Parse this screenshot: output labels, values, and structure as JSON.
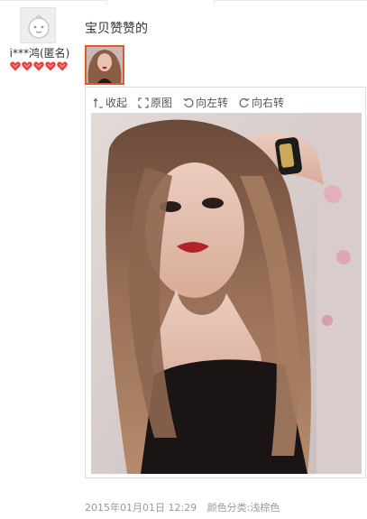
{
  "review": {
    "username": "i***鸿(匿名)",
    "rating_hearts": 5,
    "text": "宝贝赞赞的",
    "date": "2015年01月01日 12:29",
    "sku": "颜色分类:浅棕色"
  },
  "viewer": {
    "tools": [
      {
        "label": "收起",
        "icon": "collapse-icon"
      },
      {
        "label": "原图",
        "icon": "fullsize-icon"
      },
      {
        "label": "向左转",
        "icon": "rotate-left-icon"
      },
      {
        "label": "向右转",
        "icon": "rotate-right-icon"
      }
    ]
  },
  "colors": {
    "thumb_border": "#e4572e",
    "heart": "#e8413b",
    "meta_text": "#999999"
  }
}
